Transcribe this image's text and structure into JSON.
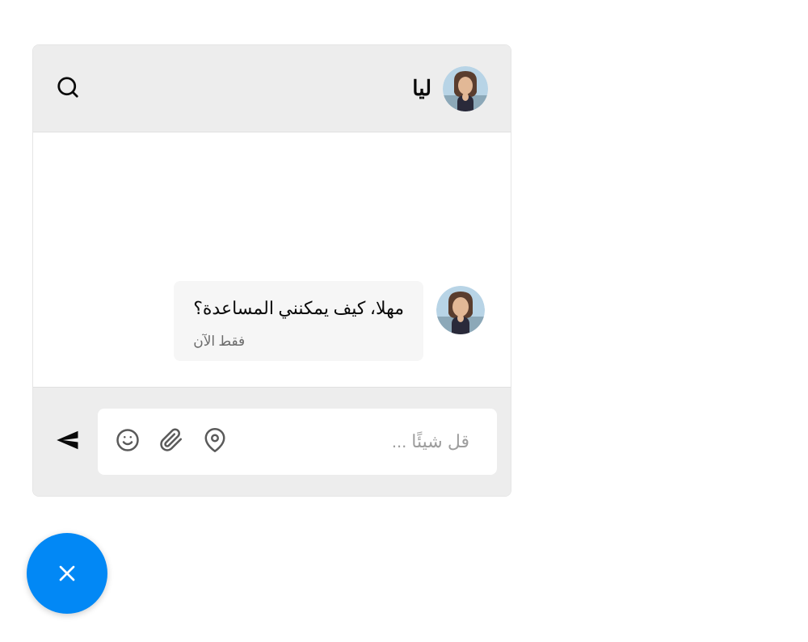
{
  "header": {
    "contact_name": "ليا"
  },
  "message": {
    "text": "مهلا، كيف يمكنني المساعدة؟",
    "time": "فقط الآن"
  },
  "composer": {
    "placeholder": "قل شيئًا ..."
  }
}
